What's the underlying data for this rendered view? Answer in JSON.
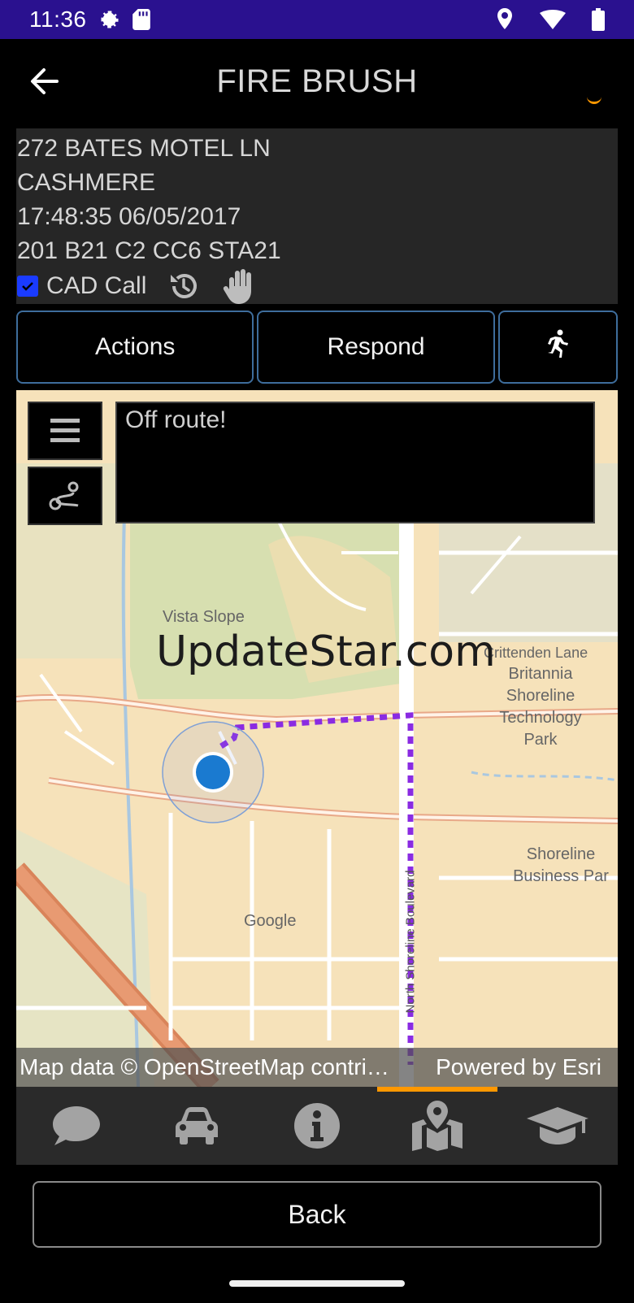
{
  "status_bar": {
    "time": "11:36",
    "left_icons": [
      "gear-icon",
      "sd-card-icon"
    ],
    "right_icons": [
      "location-icon",
      "wifi-icon",
      "battery-icon"
    ],
    "background": "#2a118f"
  },
  "header": {
    "title": "FIRE BRUSH"
  },
  "incident": {
    "address": "272 BATES MOTEL LN",
    "city": "CASHMERE",
    "timestamp": "17:48:35 06/05/2017",
    "units": "201 B21 C2 CC6 STA21",
    "cad_call_label": "CAD Call",
    "cad_call_checked": true
  },
  "buttons": {
    "actions": "Actions",
    "respond": "Respond",
    "walk_icon": "running-person-icon"
  },
  "map": {
    "message": "Off route!",
    "labels": {
      "vista_slope": "Vista Slope",
      "crittenden": "Crittenden Lane",
      "britannia": "Britannia Shoreline Technology Park",
      "shoreline_business": "Shoreline Business Par",
      "google": "Google",
      "street": "North Shoreline Boulevard"
    },
    "watermark": "UpdateStar.com",
    "attribution_left": "Map data © OpenStreetMap contri…",
    "attribution_right": "Powered by Esri",
    "route_color": "#8a2be2",
    "location_color": "#1a7ad0"
  },
  "nav": {
    "items": [
      "chat-icon",
      "car-icon",
      "info-icon",
      "map-icon",
      "graduation-cap-icon"
    ],
    "active_index": 3,
    "active_color": "#ff9800"
  },
  "footer": {
    "back_label": "Back"
  }
}
